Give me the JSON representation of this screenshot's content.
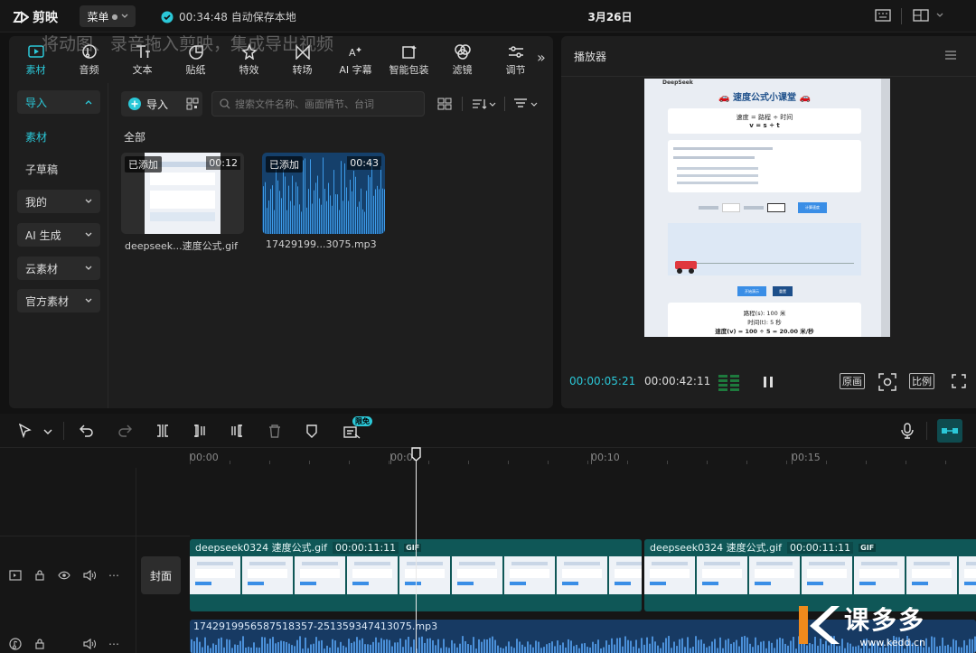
{
  "app": {
    "name": "剪映",
    "menu_label": "菜单",
    "autosave_text": "00:34:48 自动保存本地",
    "date": "3月26日"
  },
  "overlay_title": "将动图、录音拖入剪映，集成导出视频",
  "tools": [
    {
      "label": "素材",
      "icon": "media-icon"
    },
    {
      "label": "音频",
      "icon": "audio-icon"
    },
    {
      "label": "文本",
      "icon": "text-icon"
    },
    {
      "label": "贴纸",
      "icon": "sticker-icon"
    },
    {
      "label": "特效",
      "icon": "effects-icon"
    },
    {
      "label": "转场",
      "icon": "transition-icon"
    },
    {
      "label": "AI 字幕",
      "icon": "ai-caption-icon"
    },
    {
      "label": "智能包装",
      "icon": "smart-package-icon"
    },
    {
      "label": "滤镜",
      "icon": "filter-icon"
    },
    {
      "label": "调节",
      "icon": "adjust-icon"
    }
  ],
  "sidebar": {
    "import": "导入",
    "material": "素材",
    "sub_draft": "子草稿",
    "mine": "我的",
    "ai_gen": "AI 生成",
    "cloud": "云素材",
    "official": "官方素材"
  },
  "media": {
    "import_label": "导入",
    "search_placeholder": "搜索文件名称、画面情节、台词",
    "section_all": "全部",
    "items": [
      {
        "tag": "已添加",
        "duration": "00:12",
        "name": "deepseek...速度公式.gif"
      },
      {
        "tag": "已添加",
        "duration": "00:43",
        "name": "17429199...3075.mp3"
      }
    ]
  },
  "player": {
    "title": "播放器",
    "current_time": "00:00:05:21",
    "total_time": "00:00:42:11",
    "btn_original": "原画",
    "btn_ratio": "比例",
    "screen": {
      "app_name": "DeepSeek",
      "heading": "🚗 速度公式小课堂 🚗",
      "formula1": "速度 = 路程 ÷ 时间",
      "formula2": "v = s ÷ t",
      "result1": "路程(s): 100 米",
      "result2": "时间(t): 5 秒",
      "result3": "速度(v) = 100 ÷ 5 = 20.00 米/秒",
      "btn_calc": "计算速度",
      "btn_start": "开始演示",
      "btn_reset": "重置"
    }
  },
  "timeline": {
    "limited_badge": "限免",
    "ruler": [
      "00:00",
      "00:05",
      "00:10",
      "00:15"
    ],
    "cover_label": "封面",
    "video_clip_name": "deepseek0324 速度公式.gif",
    "video_clip_duration": "00:00:11:11",
    "gif_badge": "GIF",
    "audio_clip_name": "1742919956587518357-251359347413075.mp3"
  },
  "watermark": {
    "text": "课多多",
    "url": "www.kedd.cn"
  },
  "colors": {
    "accent": "#2bc8d8",
    "video_clip": "#0f5757",
    "audio_clip": "#173a63",
    "player_time": "#2bc8d8"
  }
}
